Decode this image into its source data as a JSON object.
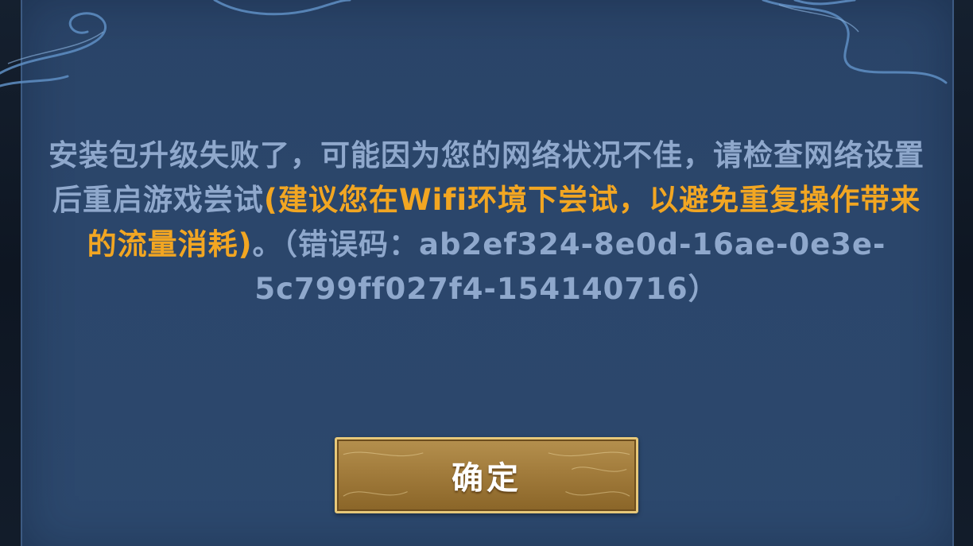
{
  "dialog": {
    "message": {
      "part1": "安装包升级失败了，可能因为您的网络状况不佳，请检查网络设置后重启游戏尝试",
      "highlight": "(建议您在Wifi环境下尝试，以避免重复操作带来的流量消耗)",
      "part2": "。（错误码：",
      "error_code": "ab2ef324-8e0d-16ae-0e3e-5c799ff027f4-154140716",
      "part3": "）"
    },
    "confirm_label": "确定"
  },
  "colors": {
    "panel_bg": "#2b466b",
    "message_text": "#8fa8cc",
    "highlight_text": "#f2a622",
    "button_gold": "#a27c3c",
    "button_border": "#e7c879"
  },
  "icons": {
    "top_ornament": "swirl-ornament"
  }
}
